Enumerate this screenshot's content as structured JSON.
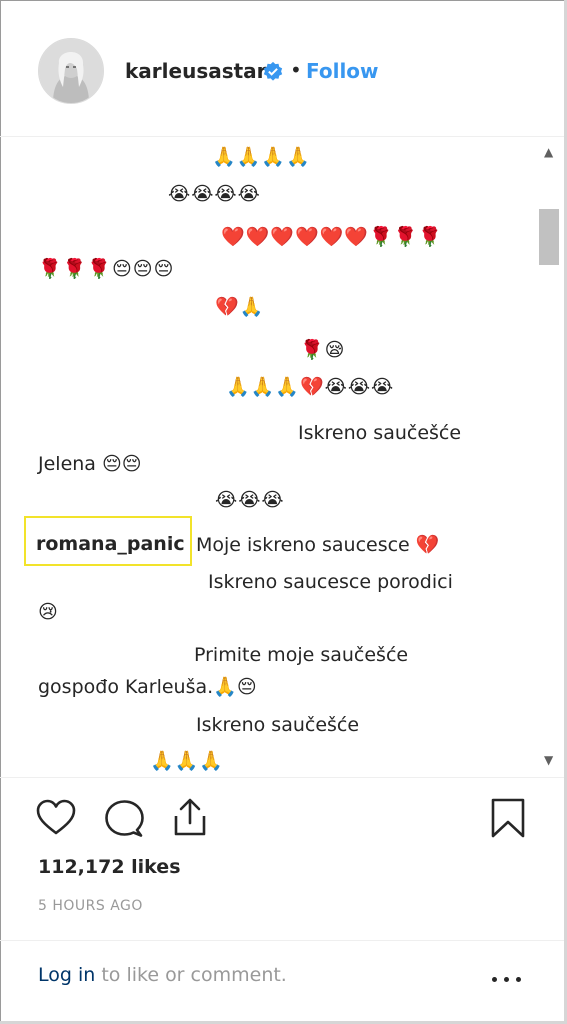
{
  "header": {
    "username": "karleusastar",
    "separator": "•",
    "follow_label": "Follow"
  },
  "comments": [
    {
      "text": "🙏🙏🙏🙏"
    },
    {
      "text": "😭😭😭😭"
    },
    {
      "text": "❤️❤️❤️❤️❤️❤️🌹🌹🌹"
    },
    {
      "text": "🌹🌹🌹😔😔😔"
    },
    {
      "text": "💔🙏"
    },
    {
      "text": "🌹😪"
    },
    {
      "text": "🙏🙏🙏💔😭😭😭"
    },
    {
      "text": "Iskreno saučešće"
    },
    {
      "text": "Jelena 😔😔"
    },
    {
      "text": "😭😭😭"
    },
    {
      "user": "romana_panic",
      "text": "Moje iskreno saucesce 💔"
    },
    {
      "text": "Iskreno saucesce porodici"
    },
    {
      "text": "😢"
    },
    {
      "text": "Primite moje saučešće"
    },
    {
      "text": "gospođo Karleuša.🙏😔"
    },
    {
      "text": "Iskreno saučešće"
    },
    {
      "text": "🙏🙏🙏"
    }
  ],
  "actions": {
    "like_icon": "heart-icon",
    "comment_icon": "comment-bubble-icon",
    "share_icon": "share-icon",
    "save_icon": "bookmark-icon"
  },
  "likes": "112,172 likes",
  "time_ago": "5 HOURS AGO",
  "footer": {
    "login_label": "Log in",
    "login_suffix": " to like or comment.",
    "more_icon": "more-options-icon"
  },
  "colors": {
    "link": "#3897f0",
    "highlight": "#f2e32a",
    "text": "#262626",
    "muted": "#999999"
  }
}
